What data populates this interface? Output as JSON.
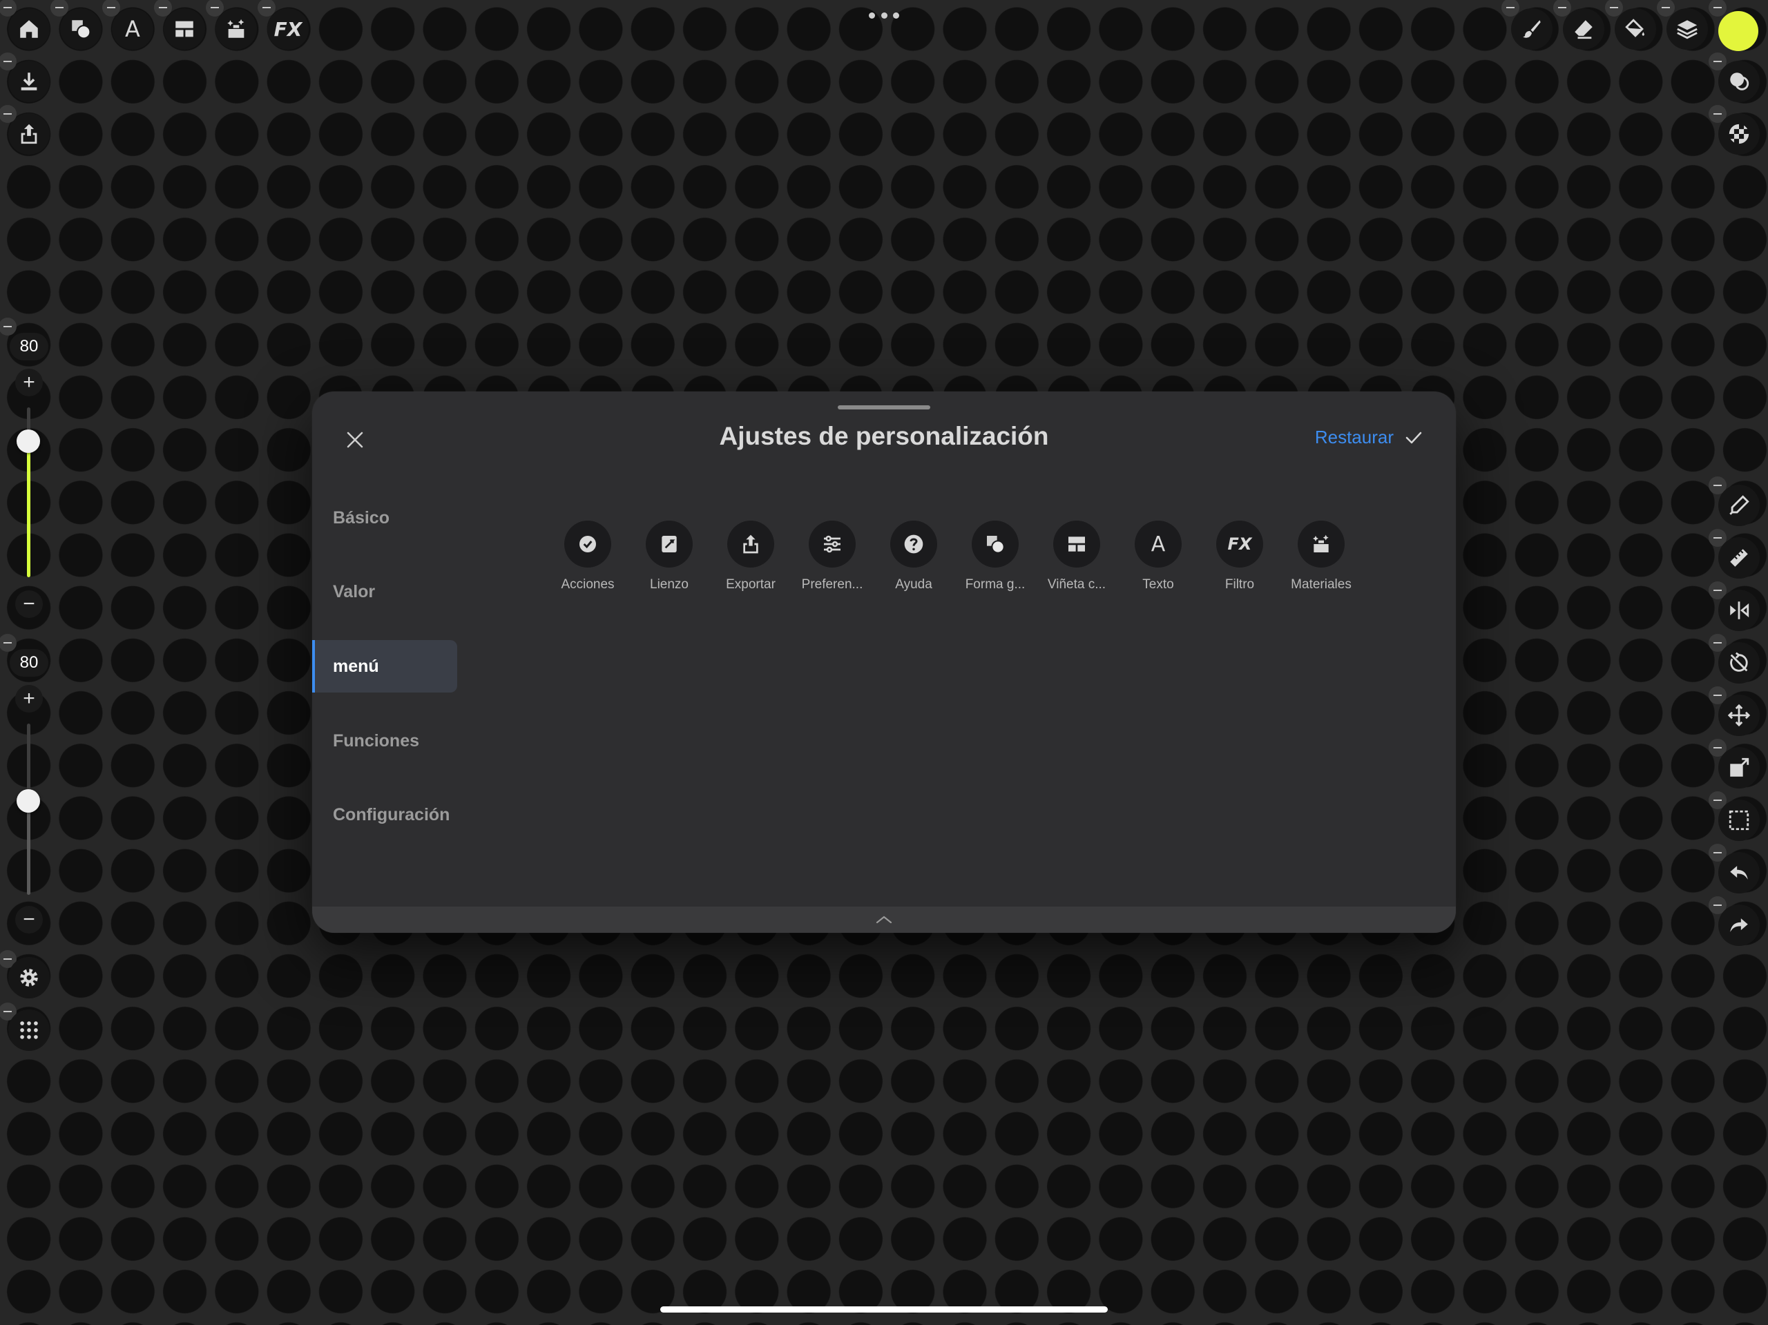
{
  "top_toolbar_left": [
    "home-icon",
    "shapes-icon",
    "text-icon",
    "panel-icon",
    "materials-icon",
    "fx-icon"
  ],
  "top_toolbar_left_text": {
    "text": "A",
    "fx": "FX"
  },
  "top_toolbar_right": [
    "brush-icon",
    "eraser-icon",
    "fill-icon",
    "layers-icon"
  ],
  "current_color": "#e3f53c",
  "left_column": [
    "download-icon",
    "share-icon"
  ],
  "slider_size": {
    "value": "80",
    "plus": "+",
    "minus": "−",
    "level_percent": 80,
    "accent": "#d7ff3c"
  },
  "slider_opacity": {
    "value": "80",
    "plus": "+",
    "minus": "−",
    "level_percent": 55
  },
  "bottom_left": [
    "gear-icon",
    "apps-grid-icon"
  ],
  "right_column": [
    "color-picker-icon",
    "ruler-icon",
    "symmetry-icon",
    "rotate-lock-icon",
    "move-icon",
    "transform-icon",
    "selection-icon",
    "undo-icon",
    "redo-icon"
  ],
  "right_top": [
    "blend-icon",
    "checker-icon"
  ],
  "modal": {
    "title": "Ajustes de personalización",
    "restore_label": "Restaurar",
    "accent": "#3d8df0",
    "nav": [
      {
        "label": "Básico",
        "active": false
      },
      {
        "label": "Valor",
        "active": false
      },
      {
        "label": "menú",
        "active": true
      },
      {
        "label": "Funciones",
        "active": false
      },
      {
        "label": "Configuración",
        "active": false
      }
    ],
    "menu_items": [
      {
        "label": "Acciones",
        "icon": "actions-icon"
      },
      {
        "label": "Lienzo",
        "icon": "canvas-icon"
      },
      {
        "label": "Exportar",
        "icon": "export-icon"
      },
      {
        "label": "Preferen...",
        "icon": "preferences-icon"
      },
      {
        "label": "Ayuda",
        "icon": "help-icon"
      },
      {
        "label": "Forma g...",
        "icon": "shape-icon"
      },
      {
        "label": "Viñeta c...",
        "icon": "vignette-icon"
      },
      {
        "label": "Texto",
        "icon": "text-icon",
        "glyph": "A"
      },
      {
        "label": "Filtro",
        "icon": "filter-icon",
        "glyph": "FX"
      },
      {
        "label": "Materiales",
        "icon": "materials-icon"
      }
    ]
  }
}
